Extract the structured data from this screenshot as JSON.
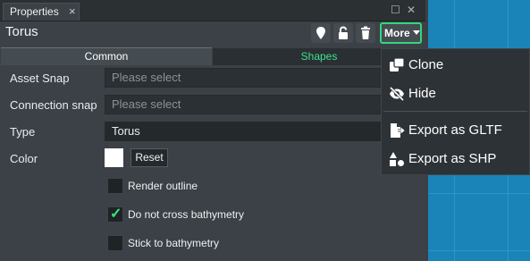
{
  "tab": {
    "label": "Properties",
    "close": "×"
  },
  "window_controls": {
    "maximize": "☐",
    "close": "✕"
  },
  "object": {
    "title": "Torus"
  },
  "toolbar": {
    "more_label": "More"
  },
  "subtabs": {
    "common": "Common",
    "shapes": "Shapes"
  },
  "fields": {
    "asset_snap": {
      "label": "Asset Snap",
      "placeholder": "Please select"
    },
    "connection_snap": {
      "label": "Connection snap",
      "placeholder": "Please select"
    },
    "type": {
      "label": "Type",
      "value": "Torus"
    },
    "color": {
      "label": "Color",
      "value": "#ffffff",
      "reset_label": "Reset"
    }
  },
  "options": [
    {
      "label": "Render outline",
      "checked": false
    },
    {
      "label": "Do not cross bathymetry",
      "checked": true
    },
    {
      "label": "Stick to bathymetry",
      "checked": false
    }
  ],
  "more_menu": {
    "items": [
      {
        "label": "Clone",
        "icon": "clone-icon"
      },
      {
        "label": "Hide",
        "icon": "eye-slash-icon"
      },
      {
        "label": "Export as GLTF",
        "icon": "file-export-icon"
      },
      {
        "label": "Export as SHP",
        "icon": "shapes-icon"
      }
    ]
  },
  "colors": {
    "accent_green": "#33d67a",
    "check_green": "#3fe47f",
    "viewport_blue": "#1a84b8"
  }
}
